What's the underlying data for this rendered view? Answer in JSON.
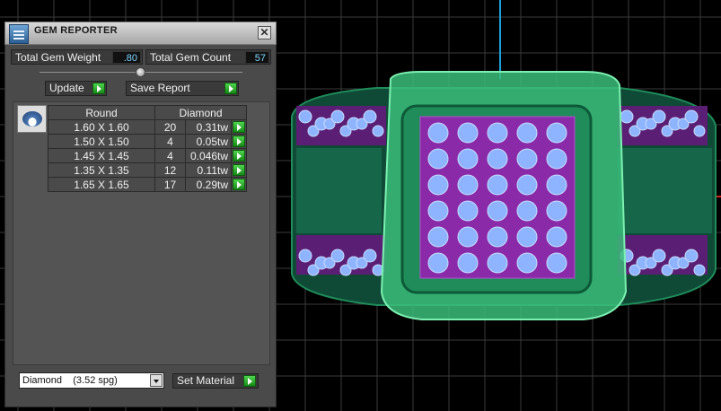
{
  "panel": {
    "title": "GEM REPORTER",
    "close_glyph": "✕",
    "total_weight_label": "Total Gem Weight",
    "total_weight_value": ".80",
    "total_count_label": "Total Gem Count",
    "total_count_value": "57",
    "slider_value": 0.5,
    "update_label": "Update",
    "save_report_label": "Save Report",
    "table": {
      "headers": [
        "Round",
        "Diamond"
      ],
      "rows": [
        {
          "size": "1.60 X 1.60",
          "count": "20",
          "weight": "0.31tw"
        },
        {
          "size": "1.50 X 1.50",
          "count": "4",
          "weight": "0.05tw"
        },
        {
          "size": "1.45 X 1.45",
          "count": "4",
          "weight": "0.046tw"
        },
        {
          "size": "1.35 X 1.35",
          "count": "12",
          "weight": "0.11tw"
        },
        {
          "size": "1.65 X 1.65",
          "count": "17",
          "weight": "0.29tw"
        }
      ]
    },
    "material_selected": "Diamond    (3.52 spg)",
    "set_material_label": "Set Material"
  },
  "icons": {
    "app": "gem-reporter-app-icon",
    "close": "close-icon",
    "go": "play-arrow-icon",
    "gem": "round-gem-icon",
    "dropdown": "chevron-down-icon"
  },
  "colors": {
    "panel_bg": "#4a4a4a",
    "value_text": "#7fd6ff",
    "go_green": "#2db52d",
    "ring_green": "#3bbd7a",
    "gem_blue": "#8fb4ff",
    "gem_purple": "#8a2aa8",
    "grid": "#3a3a3a"
  }
}
